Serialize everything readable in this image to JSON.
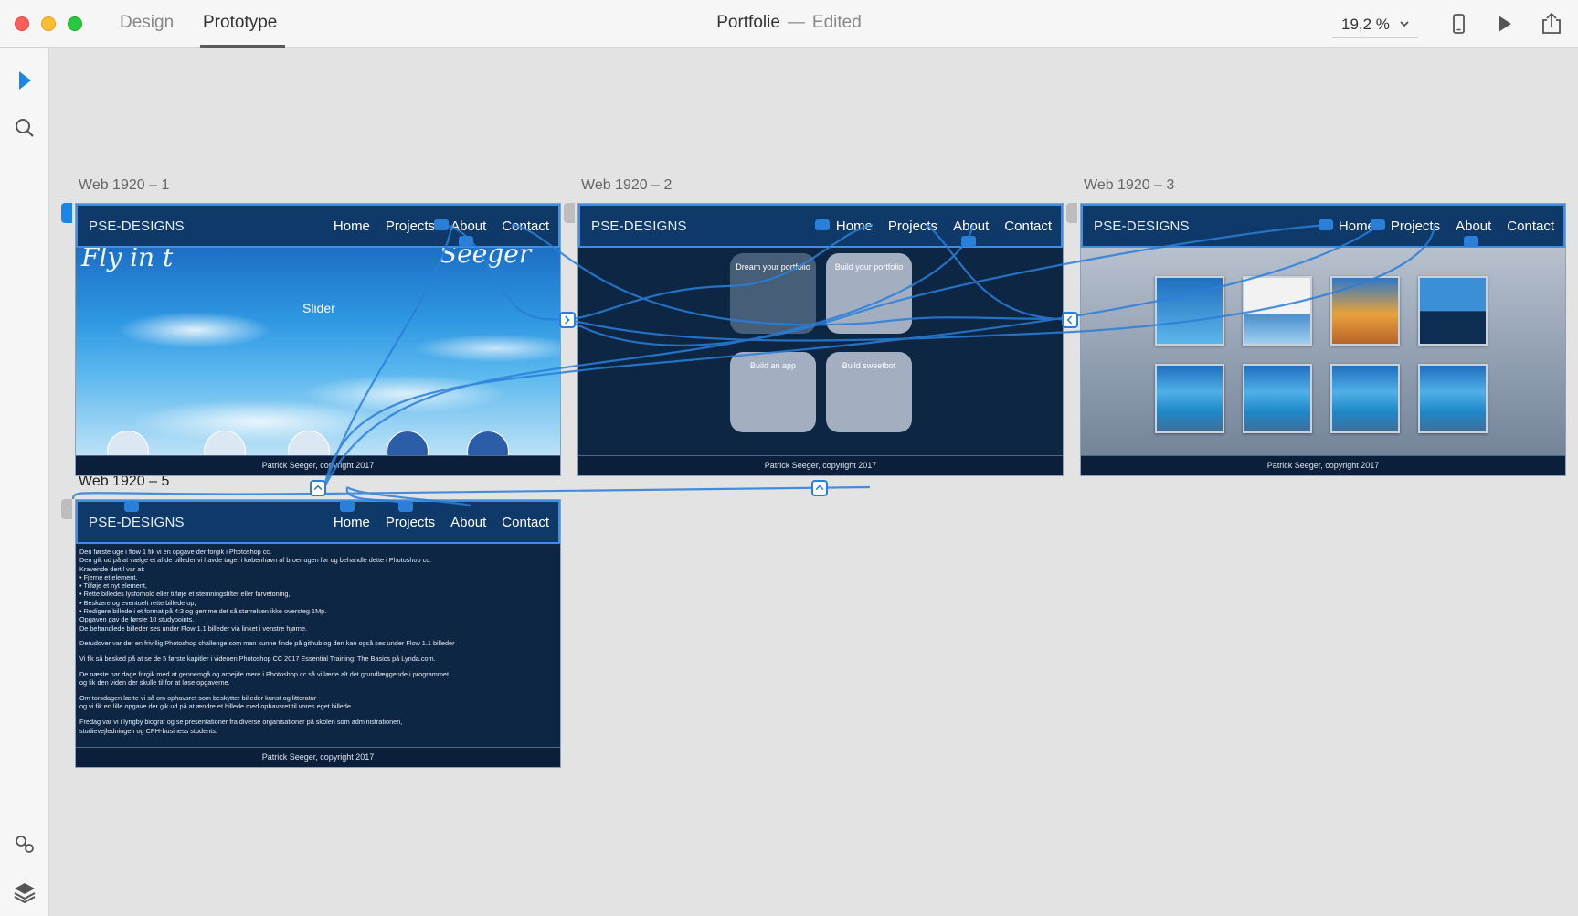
{
  "window": {
    "tabs": [
      "Design",
      "Prototype"
    ],
    "active_tab": "Prototype",
    "document_name": "Portfolie",
    "separator": "—",
    "document_state": "Edited",
    "zoom": "19,2 %"
  },
  "colors": {
    "accent": "#2a7fd9",
    "artboard_bg": "#0d2644",
    "nav_bg": "#0e3968"
  },
  "toolbar_icons": [
    "select-tool-icon",
    "zoom-tool-icon",
    "assets-icon",
    "layers-icon"
  ],
  "header_icons": [
    "device-preview-icon",
    "play-icon",
    "share-icon"
  ],
  "artboards": [
    {
      "label": "Web 1920 – 1",
      "logo": "PSE-DESIGNS",
      "menu": [
        "Home",
        "Projects",
        "About",
        "Contact"
      ],
      "slider_label": "Slider",
      "footer": "Patrick Seeger, copyright 2017"
    },
    {
      "label": "Web 1920 – 2",
      "logo": "PSE-DESIGNS",
      "menu": [
        "Home",
        "Projects",
        "About",
        "Contact"
      ],
      "tiles": [
        "Dream your portfolio",
        "Build your portfolio",
        "Build an app",
        "Build sweetbot"
      ],
      "footer": "Patrick Seeger, copyright 2017"
    },
    {
      "label": "Web 1920 – 3",
      "logo": "PSE-DESIGNS",
      "menu": [
        "Home",
        "Projects",
        "About",
        "Contact"
      ],
      "footer": "Patrick Seeger, copyright 2017"
    },
    {
      "label": "Web 1920 – 5",
      "logo": "PSE-DESIGNS",
      "menu": [
        "Home",
        "Projects",
        "About",
        "Contact"
      ],
      "body": [
        "Den første uge i flow 1 fik vi en opgave der forgik i Photoshop cc.\nDen gik ud på at vælge et af de billeder vi havde taget i københavn af broer ugen før og behandle dette i Photoshop cc.\nKravende dertil var at:\n•  Fjerne et element,\n•  Tilføje et nyt element,\n•  Rette billedes lysforhold eller tilføje et stemningsfilter eller farvetoning,\n•  Beskære og eventuelt rette billede op,\n•  Redigere billede i et format på 4:3 og gemme det så størrelsen ikke oversteg 1Mp.\nOpgaven gav de første 10 studypoints.\nDe behandlede billeder ses under Flow 1.1 billeder via linket i venstre hjørne.",
        "Derudover var der en frivillig Photoshop challenge som man kunne finde på github og den kan også ses under Flow 1.1 billeder",
        "Vi fik så besked på at se de 5 første kapitler i videoen Photoshop CC 2017 Essential Training: The Basics på Lynda.com.",
        "De næste par dage forgik med at gennemgå og arbejde mere i Photoshop cc så vi lærte alt det grundlæggende i programmet\nog fik den viden der skulle til for at løse opgaverne.",
        "Om torsdagen lærte vi så om ophavsret som beskytter billeder kunst og litteratur\nog vi fik en lille opgave der gik ud på at ændre et billede med ophavsret til vores eget billede.",
        "Fredag var vi i lyngby biograf og se presentationer fra diverse organisationer på skolen som administrationen,\nstudievejledningen og CPH-business students."
      ],
      "footer": "Patrick Seeger, copyright 2017"
    }
  ]
}
